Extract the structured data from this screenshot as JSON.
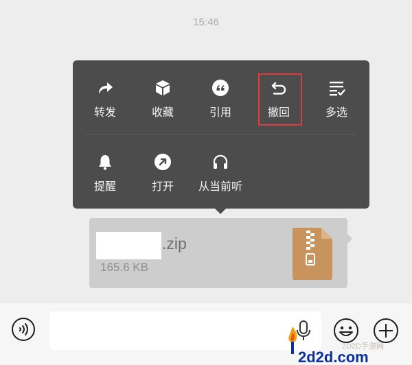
{
  "timestamp": "15:46",
  "context_menu": {
    "row1": [
      {
        "label": "转发",
        "icon": "forward-icon"
      },
      {
        "label": "收藏",
        "icon": "favorite-cube-icon"
      },
      {
        "label": "引用",
        "icon": "quote-icon"
      },
      {
        "label": "撤回",
        "icon": "undo-recall-icon",
        "highlighted": true
      },
      {
        "label": "多选",
        "icon": "multi-select-icon"
      }
    ],
    "row2": [
      {
        "label": "提醒",
        "icon": "bell-icon"
      },
      {
        "label": "打开",
        "icon": "open-arrow-icon"
      },
      {
        "label": "从当前听",
        "icon": "headphones-icon"
      }
    ],
    "highlight_color": "#e4393c"
  },
  "file_message": {
    "extension": ".zip",
    "size": "165.6 KB",
    "icon": "zip-archive-icon",
    "icon_color": "#c8935d"
  },
  "input_bar": {
    "voice_icon": "voice-wave-icon",
    "mic_icon": "microphone-icon",
    "emoji_icon": "emoji-icon",
    "plus_icon": "plus-icon"
  },
  "watermark": {
    "site_name": "2D2D手游网",
    "domain": "2d2d.com"
  }
}
